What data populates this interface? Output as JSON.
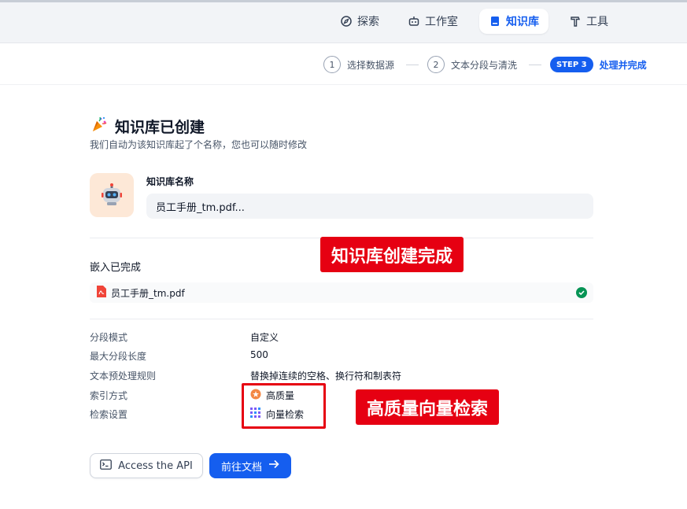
{
  "nav": {
    "items": [
      {
        "label": "探索",
        "icon": "compass-icon"
      },
      {
        "label": "工作室",
        "icon": "robot-icon"
      },
      {
        "label": "知识库",
        "icon": "book-icon",
        "active": true
      },
      {
        "label": "工具",
        "icon": "hammer-icon"
      }
    ]
  },
  "steps": {
    "items": [
      {
        "number": "1",
        "label": "选择数据源"
      },
      {
        "number": "2",
        "label": "文本分段与清洗"
      },
      {
        "badge": "STEP 3",
        "label": "处理并完成",
        "active": true
      }
    ]
  },
  "main": {
    "title": "知识库已创建",
    "title_icon": "party-popper-icon",
    "subtitle": "我们自动为该知识库起了个名称，您也可以随时修改",
    "name_label": "知识库名称",
    "name_value": "员工手册_tm.pdf...",
    "embed_label": "嵌入已完成",
    "file_name": "员工手册_tm.pdf",
    "settings": [
      {
        "key": "分段模式",
        "value": "自定义"
      },
      {
        "key": "最大分段长度",
        "value": "500"
      },
      {
        "key": "文本预处理规则",
        "value": "替换掉连续的空格、换行符和制表符"
      },
      {
        "key": "索引方式",
        "value": "高质量",
        "icon": "star-badge-icon"
      },
      {
        "key": "检索设置",
        "value": "向量检索",
        "icon": "vector-grid-icon"
      }
    ],
    "api_button": "Access the API",
    "doc_button": "前往文档"
  },
  "annotations": {
    "created": "知识库创建完成",
    "vector": "高质量向量检索"
  },
  "colors": {
    "accent": "#155eef",
    "success": "#079455",
    "annotation": "#e60012"
  }
}
